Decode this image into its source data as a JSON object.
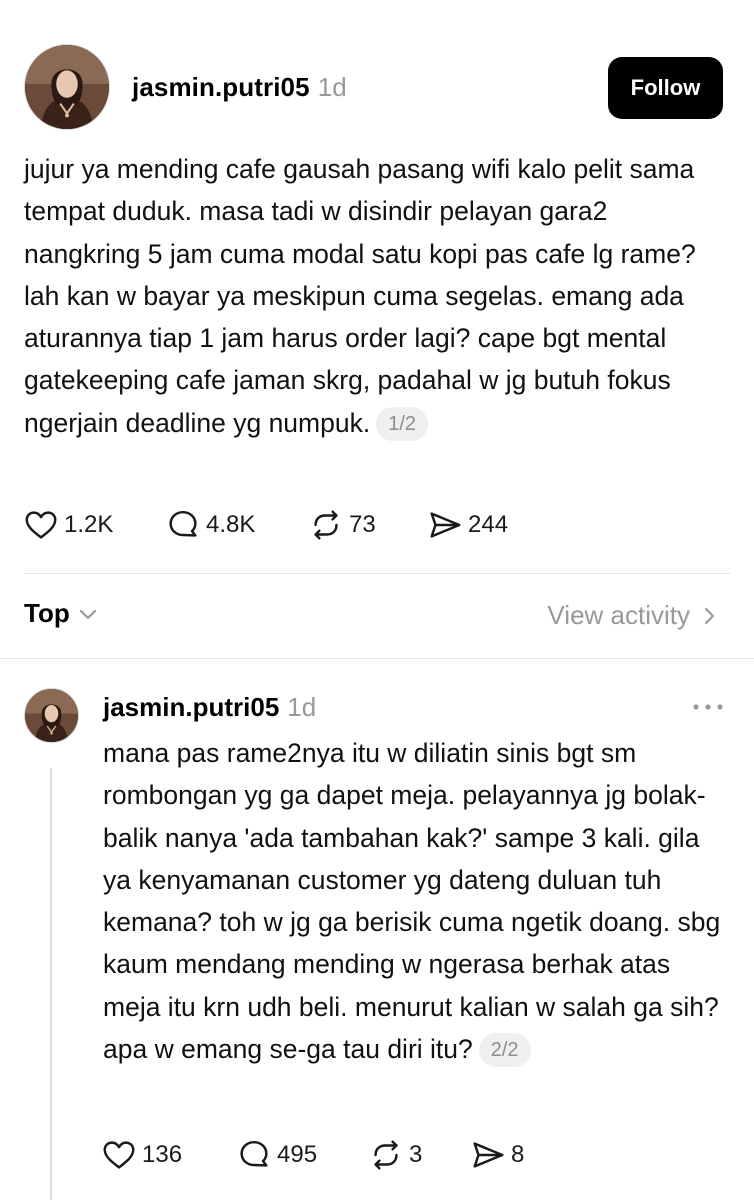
{
  "main_post": {
    "username": "jasmin.putri05",
    "time": "1d",
    "follow_label": "Follow",
    "text": "jujur ya mending cafe gausah pasang wifi kalo pelit sama tempat duduk. masa tadi w disindir pelayan gara2 nangkring 5 jam cuma modal satu kopi pas cafe lg rame? lah kan w bayar ya meskipun cuma segelas. emang ada aturannya tiap 1 jam harus order lagi? cape bgt mental gatekeeping cafe jaman skrg, padahal w jg butuh fokus ngerjain deadline yg numpuk.",
    "page_indicator": "1/2",
    "likes": "1.2K",
    "replies": "4.8K",
    "reposts": "73",
    "shares": "244"
  },
  "sort_bar": {
    "sort_label": "Top",
    "view_activity_label": "View activity"
  },
  "reply": {
    "username": "jasmin.putri05",
    "time": "1d",
    "text": "mana pas rame2nya itu w diliatin sinis bgt sm rombongan yg ga dapet meja. pelayannya jg bolak-balik nanya 'ada tambahan kak?' sampe 3 kali. gila ya kenyamanan customer yg dateng duluan tuh kemana? toh w jg ga berisik cuma ngetik doang. sbg kaum mendang mending w ngerasa berhak atas meja itu krn udh beli. menurut kalian w salah ga sih? apa w emang se-ga tau diri itu?",
    "page_indicator": "2/2",
    "likes": "136",
    "replies": "495",
    "reposts": "3",
    "shares": "8"
  },
  "icons": {
    "like": "heart-icon",
    "reply": "comment-icon",
    "repost": "repost-icon",
    "share": "share-icon",
    "sort": "chevron-down-icon",
    "view_activity": "chevron-right-icon",
    "more": "more-icon"
  },
  "colors": {
    "follow_button_bg": "#000000",
    "muted_text": "#999999",
    "badge_bg": "#efefef"
  }
}
